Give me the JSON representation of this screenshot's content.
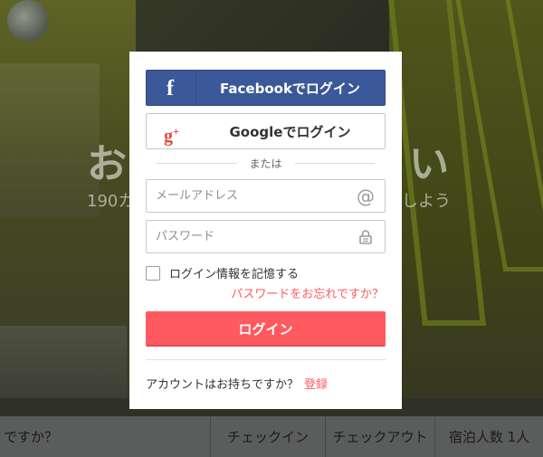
{
  "background": {
    "hero_title_left": "お",
    "hero_title_right": "い",
    "hero_sub_left": "190カ",
    "hero_sub_right": "しよう"
  },
  "searchbar": {
    "where_placeholder": "ですか？",
    "checkin": "チェックイン",
    "checkout": "チェックアウト",
    "guests": "宿泊人数 1人"
  },
  "modal": {
    "facebook_label": "Facebookでログイン",
    "facebook_icon": "facebook-icon",
    "google_label": "Googleでログイン",
    "google_icon": "google-plus-icon",
    "divider_text": "または",
    "email_placeholder": "メールアドレス",
    "email_icon": "at-icon",
    "password_placeholder": "パスワード",
    "password_icon": "lock-icon",
    "remember_label": "ログイン情報を記憶する",
    "remember_checked": false,
    "forgot_link": "パスワードをお忘れですか？",
    "login_button": "ログイン",
    "signup_prompt": "アカウントはお持ちですか？",
    "signup_link": "登録"
  },
  "colors": {
    "facebook": "#3b5998",
    "google_red": "#dd4b39",
    "accent": "#ff5a5f",
    "overlay": "#2b2e22"
  }
}
